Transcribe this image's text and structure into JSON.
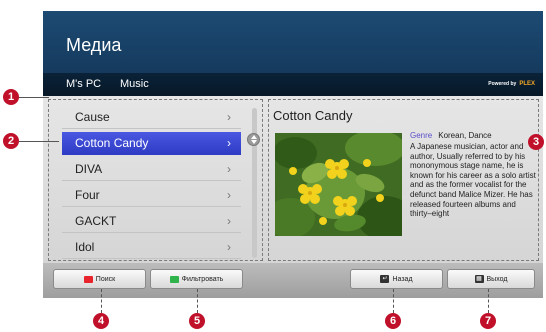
{
  "header": {
    "title": "Медиа"
  },
  "breadcrumb": {
    "items": [
      "M's PC",
      "Music"
    ],
    "powered_by": "Powered by",
    "brand": "PLEX"
  },
  "list": {
    "items": [
      "Cause",
      "Cotton Candy",
      "DIVA",
      "Four",
      "GACKT",
      "Idol"
    ],
    "selected_index": 1,
    "arrow": "›"
  },
  "detail": {
    "title": "Cotton Candy",
    "genre_label": "Genre",
    "genre_value": "Korean, Dance",
    "bio": "A Japanese musician, actor and author, Usually referred to by his mononymous stage name, he is known for his career as a solo artist and as the former vocalist for the defunct band Malice Mizer. He has released fourteen albums and thirty–eight"
  },
  "footer": {
    "search_label": "Поиск",
    "filter_label": "Фильтровать",
    "back_label": "Назад",
    "exit_label": "Выход",
    "red_key_color": "#e8232c",
    "green_key_color": "#2fb34a"
  },
  "callouts": [
    "1",
    "2",
    "4",
    "5",
    "6",
    "7",
    "3"
  ],
  "colors": {
    "accent": "#3a48d6",
    "callout": "#c0102a",
    "header": "#1d4a72"
  }
}
